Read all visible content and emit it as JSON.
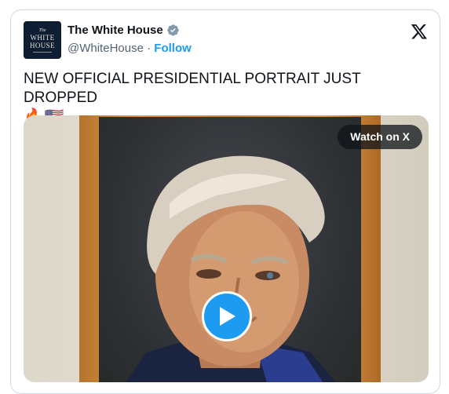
{
  "account": {
    "display_name": "The White House",
    "handle": "@WhiteHouse",
    "separator": "·",
    "follow_label": "Follow",
    "avatar": {
      "line1": "The",
      "line2": "WHITE",
      "line3": "HOUSE"
    }
  },
  "tweet": {
    "text": "NEW OFFICIAL PRESIDENTIAL PORTRAIT JUST DROPPED",
    "emojis": [
      "🔥",
      "🇺🇸"
    ]
  },
  "media": {
    "watch_label": "Watch on X"
  },
  "colors": {
    "accent": "#1d9bf0",
    "text": "#0f1419",
    "secondary": "#536471",
    "border": "#cfd9de"
  },
  "icons": [
    "verified-badge-icon",
    "x-logo-icon",
    "play-icon"
  ]
}
